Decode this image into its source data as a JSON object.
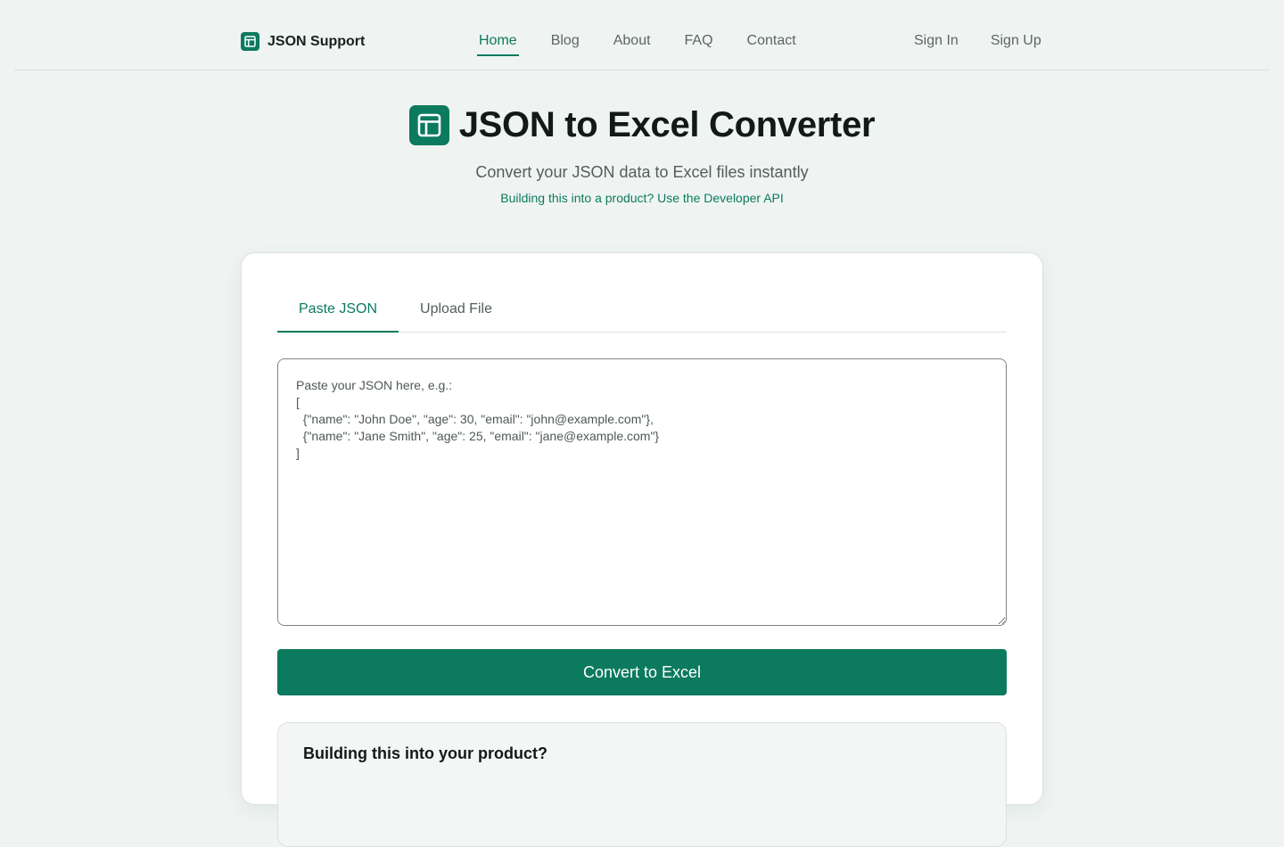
{
  "nav": {
    "brand": "JSON Support",
    "brand_icon": "table-icon",
    "links": [
      "Home",
      "Blog",
      "About",
      "FAQ",
      "Contact"
    ],
    "active": "Home",
    "sign_in": "Sign In",
    "sign_up": "Sign Up"
  },
  "hero": {
    "icon": "table-icon",
    "title": "JSON to Excel Converter",
    "subtitle": "Convert your JSON data to Excel files instantly",
    "api_link": "Building this into a product? Use the Developer API"
  },
  "converter": {
    "tabs": [
      "Paste JSON",
      "Upload File"
    ],
    "active_tab": "Paste JSON",
    "input_value": "",
    "input_placeholder": "Paste your JSON here, e.g.:\n[\n  {\"name\": \"John Doe\", \"age\": 30, \"email\": \"john@example.com\"},\n  {\"name\": \"Jane Smith\", \"age\": 25, \"email\": \"jane@example.com\"}\n]",
    "button_label": "Convert to Excel"
  },
  "product_box": {
    "heading": "Building this into your product?"
  },
  "colors": {
    "accent": "#0c7a5e",
    "page_background": "#eff4f2",
    "card_background": "#ffffff"
  }
}
